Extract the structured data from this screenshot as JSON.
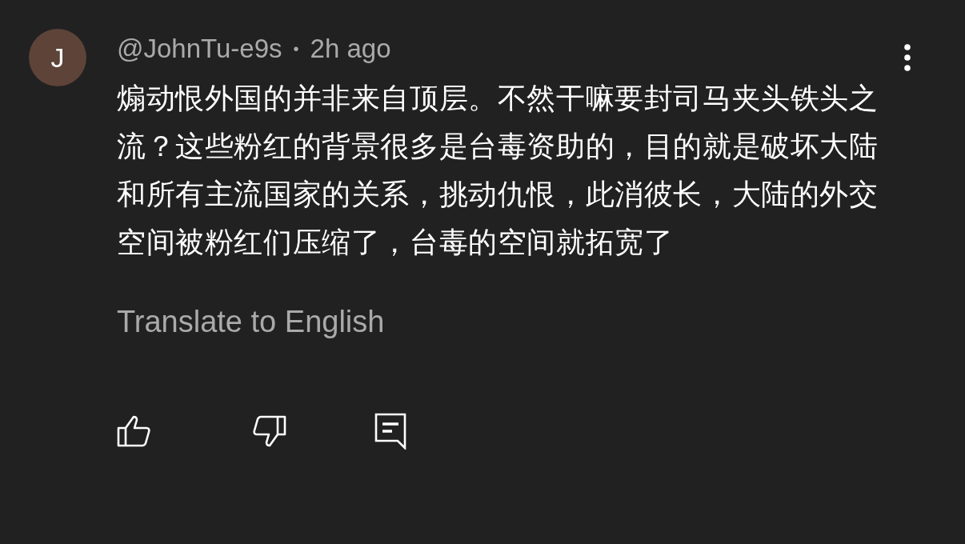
{
  "comment": {
    "avatar_letter": "J",
    "author": "@JohnTu-e9s",
    "separator": "•",
    "time": "2h ago",
    "text": "煽动恨外国的并非来自顶层。不然干嘛要封司马夹头铁头之流？这些粉红的背景很多是台毒资助的，目的就是破坏大陆和所有主流国家的关系，挑动仇恨，此消彼长，大陆的外交空间被粉红们压缩了，台毒的空间就拓宽了",
    "translate_link": "Translate to English"
  }
}
